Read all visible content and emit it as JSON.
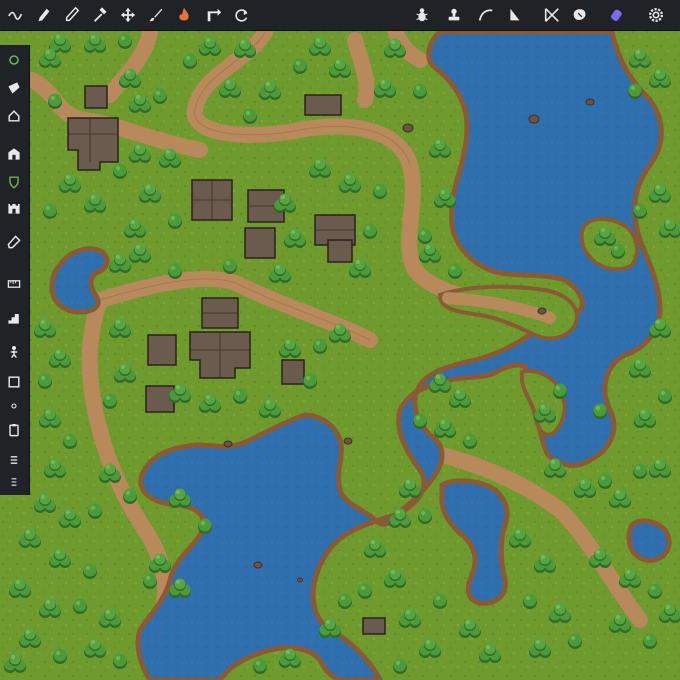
{
  "colors": {
    "grass": "#6f9b2e",
    "grass_dark": "#567e22",
    "water": "#2f6fae",
    "water_edge": "#24578c",
    "dirt": "#b8895a",
    "shore": "#8a5a34",
    "tree": "#4c9a3a",
    "tree_dark": "#2f6b27",
    "roof": "#6b5a4e",
    "toolbar_bg": "#1f2227",
    "icon": "#e8e8e8",
    "accent_orange": "#e8733a",
    "accent_purple": "#7a6bf2"
  },
  "toolbar": {
    "left_tools": [
      "wave-brush-icon",
      "pen-icon",
      "pencil-icon",
      "hammer-icon",
      "move-arrows-icon",
      "paintbrush-icon",
      "fire-icon",
      "select-arrow-icon",
      "rotate-icon"
    ],
    "right_tools": [
      "bug-icon",
      "stamp-icon",
      "curve-icon",
      "triangle-icon",
      "mirror-icon",
      "shape-icon",
      "paint-roller-icon",
      "settings-icon"
    ]
  },
  "sidebar": {
    "tools": [
      "layers-icon",
      "terrain-brush-icon",
      "house-icon",
      "building-icon",
      "shield-icon",
      "castle-icon",
      "eraser-icon",
      "ruler-icon",
      "stairs-icon",
      "figure-icon",
      "frame-icon",
      "dot-icon",
      "clipboard-icon",
      "list-icon",
      "more-icon"
    ]
  }
}
